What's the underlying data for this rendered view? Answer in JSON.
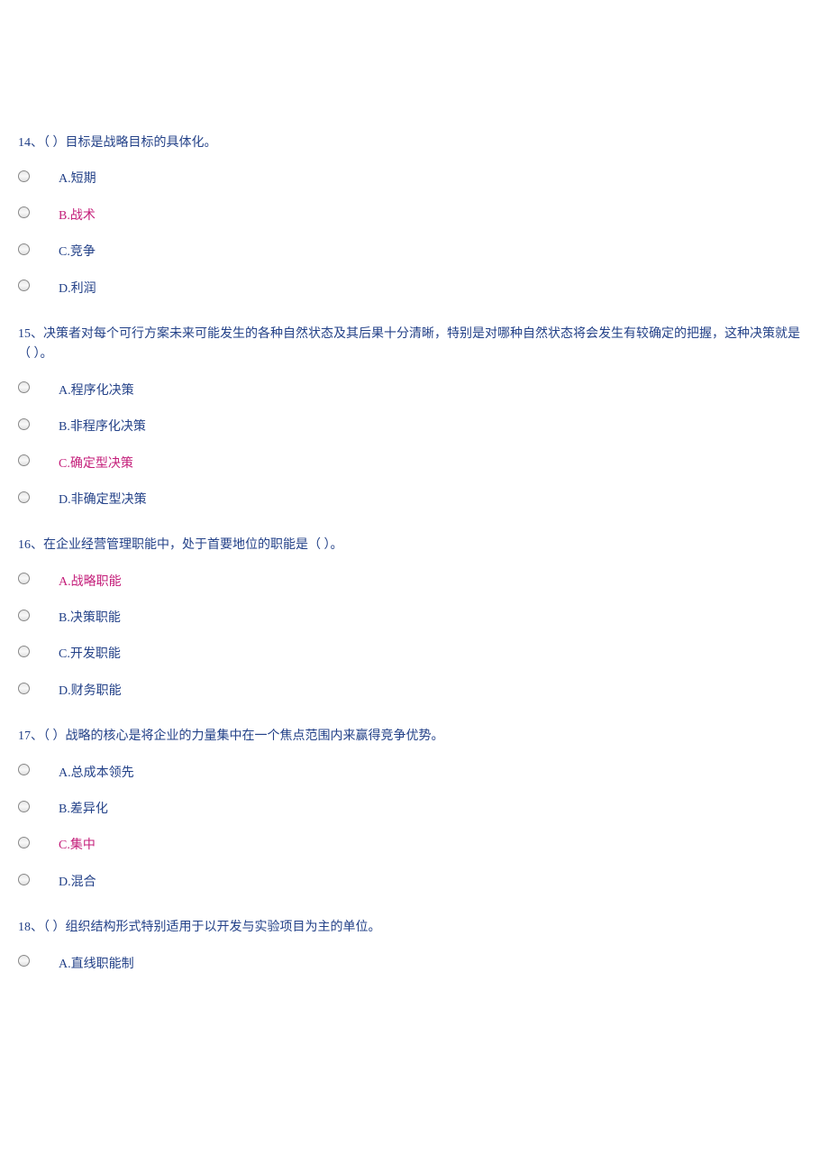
{
  "questions": [
    {
      "number": "14",
      "text": "14、（  ）目标是战略目标的具体化。",
      "options": [
        {
          "label": "A.短期",
          "highlighted": false
        },
        {
          "label": "B.战术",
          "highlighted": true
        },
        {
          "label": "C.竞争",
          "highlighted": false
        },
        {
          "label": "D.利润",
          "highlighted": false
        }
      ]
    },
    {
      "number": "15",
      "text": "15、决策者对每个可行方案未来可能发生的各种自然状态及其后果十分清晰，特别是对哪种自然状态将会发生有较确定的把握，这种决策就是（  ）。",
      "options": [
        {
          "label": "A.程序化决策",
          "highlighted": false
        },
        {
          "label": "B.非程序化决策",
          "highlighted": false
        },
        {
          "label": "C.确定型决策",
          "highlighted": true
        },
        {
          "label": "D.非确定型决策",
          "highlighted": false
        }
      ]
    },
    {
      "number": "16",
      "text": "16、在企业经营管理职能中，处于首要地位的职能是（  ）。",
      "options": [
        {
          "label": "A.战略职能",
          "highlighted": true
        },
        {
          "label": "B.决策职能",
          "highlighted": false
        },
        {
          "label": "C.开发职能",
          "highlighted": false
        },
        {
          "label": "D.财务职能",
          "highlighted": false
        }
      ]
    },
    {
      "number": "17",
      "text": "17、（  ）战略的核心是将企业的力量集中在一个焦点范围内来赢得竞争优势。",
      "options": [
        {
          "label": "A.总成本领先",
          "highlighted": false
        },
        {
          "label": "B.差异化",
          "highlighted": false
        },
        {
          "label": "C.集中",
          "highlighted": true
        },
        {
          "label": "D.混合",
          "highlighted": false
        }
      ]
    },
    {
      "number": "18",
      "text": "18、（  ）组织结构形式特别适用于以开发与实验项目为主的单位。",
      "options": [
        {
          "label": "A.直线职能制",
          "highlighted": false
        }
      ]
    }
  ]
}
